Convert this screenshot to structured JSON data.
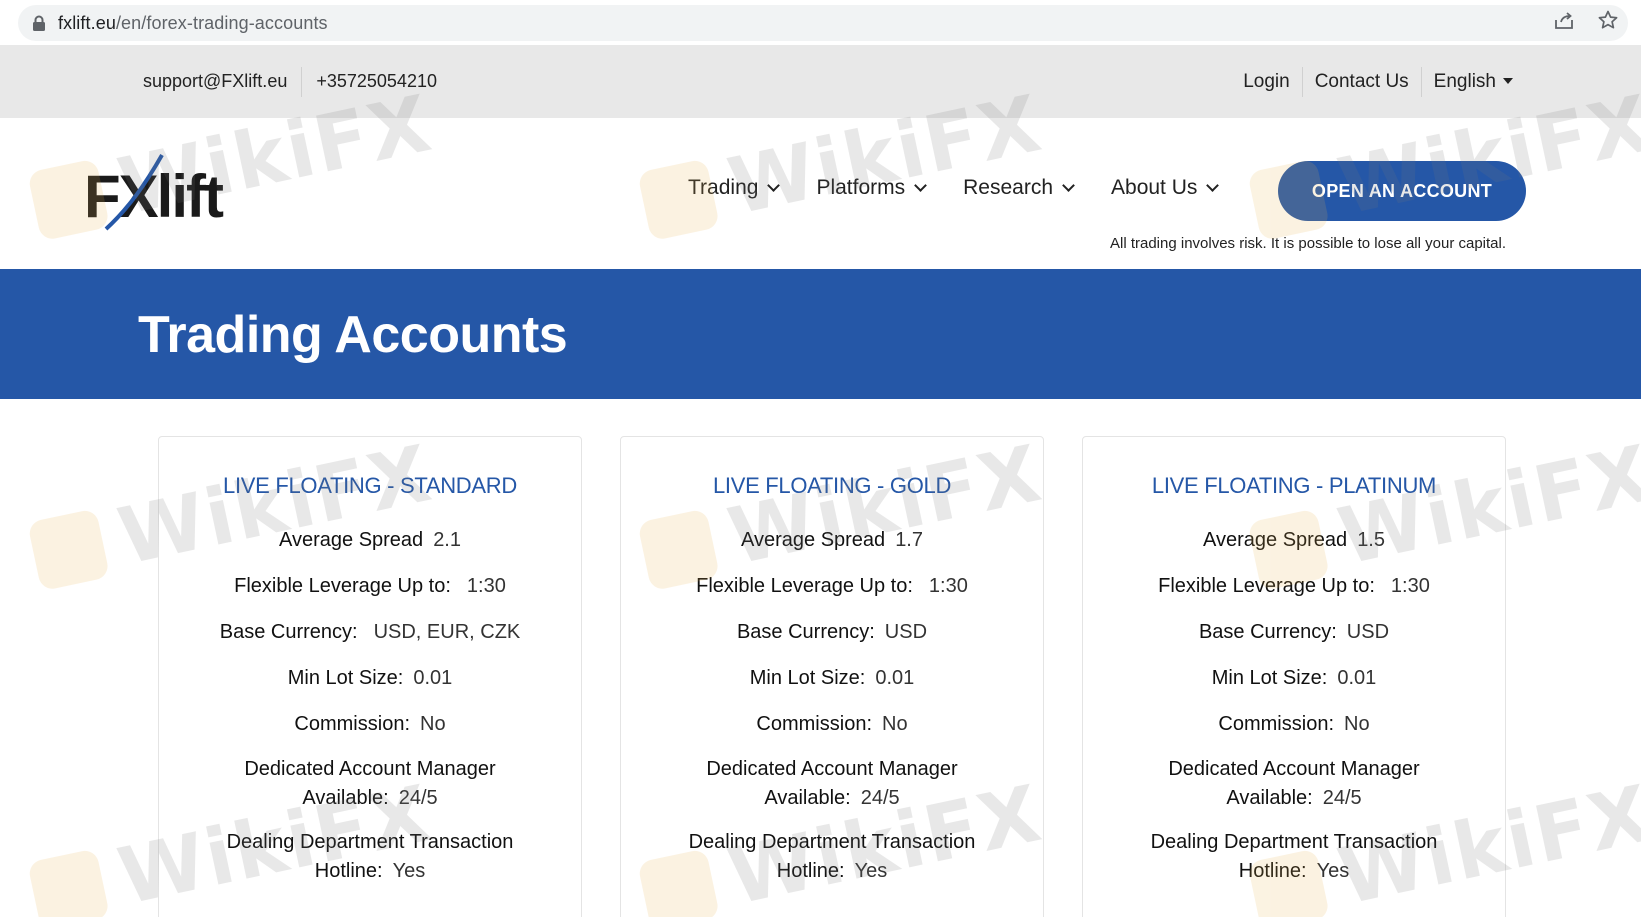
{
  "browser": {
    "url_host": "fxlift.eu",
    "url_path": "/en/forex-trading-accounts",
    "icons": [
      "lock-icon",
      "share-icon",
      "star-icon"
    ]
  },
  "topbar": {
    "email": "support@FXlift.eu",
    "phone": "+35725054210",
    "login": "Login",
    "contact": "Contact Us",
    "language": "English"
  },
  "header": {
    "logo_text": "FXlift",
    "nav": [
      {
        "label": "Trading"
      },
      {
        "label": "Platforms"
      },
      {
        "label": "Research"
      },
      {
        "label": "About Us"
      }
    ],
    "cta_label": "OPEN AN ACCOUNT",
    "risk_notice": "All trading involves risk. It is possible to lose all your capital.",
    "colors": {
      "brand_blue": "#2557a7"
    }
  },
  "hero": {
    "title": "Trading Accounts"
  },
  "watermark_text": "WikiFX",
  "cards": [
    {
      "title": "LIVE FLOATING - STANDARD",
      "spread_label": "Average Spread",
      "spread": "2.1",
      "leverage_label": "Flexible Leverage Up to:",
      "leverage": "1:30",
      "currency_label": "Base Currency:",
      "currency": "USD, EUR, CZK",
      "lot_label": "Min Lot Size:",
      "lot": "0.01",
      "commission_label": "Commission:",
      "commission": "No",
      "manager_label_1": "Dedicated Account Manager",
      "manager_label_2": "Available:",
      "manager": "24/5",
      "hotline_label_1": "Dealing Department Transaction",
      "hotline_label_2": "Hotline:",
      "hotline": "Yes"
    },
    {
      "title": "LIVE FLOATING - GOLD",
      "spread_label": "Average Spread",
      "spread": "1.7",
      "leverage_label": "Flexible Leverage Up to:",
      "leverage": "1:30",
      "currency_label": "Base Currency:",
      "currency": "USD",
      "lot_label": "Min Lot Size:",
      "lot": "0.01",
      "commission_label": "Commission:",
      "commission": "No",
      "manager_label_1": "Dedicated Account Manager",
      "manager_label_2": "Available:",
      "manager": "24/5",
      "hotline_label_1": "Dealing Department Transaction",
      "hotline_label_2": "Hotline:",
      "hotline": "Yes"
    },
    {
      "title": "LIVE FLOATING - PLATINUM",
      "spread_label": "Average Spread",
      "spread": "1.5",
      "leverage_label": "Flexible Leverage Up to:",
      "leverage": "1:30",
      "currency_label": "Base Currency:",
      "currency": "USD",
      "lot_label": "Min Lot Size:",
      "lot": "0.01",
      "commission_label": "Commission:",
      "commission": "No",
      "manager_label_1": "Dedicated Account Manager",
      "manager_label_2": "Available:",
      "manager": "24/5",
      "hotline_label_1": "Dealing Department Transaction",
      "hotline_label_2": "Hotline:",
      "hotline": "Yes"
    }
  ]
}
